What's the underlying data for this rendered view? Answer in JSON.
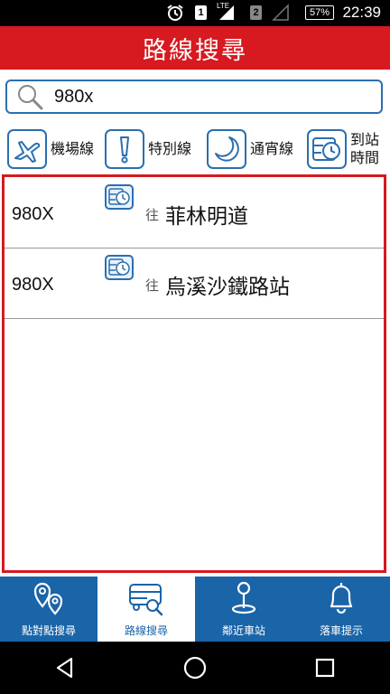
{
  "status": {
    "time": "22:39",
    "battery": "57%",
    "sim1": "1",
    "sim2": "2",
    "network": "LTE"
  },
  "title": "路線搜尋",
  "search": {
    "value": "980x"
  },
  "filters": [
    {
      "label": "機場線",
      "icon": "plane-icon"
    },
    {
      "label": "特別線",
      "icon": "exclamation-icon"
    },
    {
      "label": "通宵線",
      "icon": "moon-icon"
    },
    {
      "label": "到站時間",
      "line1": "到站",
      "line2": "時間",
      "icon": "bus-clock-icon"
    }
  ],
  "results": [
    {
      "route": "980X",
      "direction": "往",
      "destination": "菲林明道"
    },
    {
      "route": "980X",
      "direction": "往",
      "destination": "烏溪沙鐵路站"
    }
  ],
  "tabs": [
    {
      "label": "點對點搜尋",
      "icon": "map-pins-icon"
    },
    {
      "label": "路線搜尋",
      "icon": "bus-search-icon",
      "active": true
    },
    {
      "label": "鄰近車站",
      "icon": "location-pin-icon"
    },
    {
      "label": "落車提示",
      "icon": "bell-icon"
    }
  ],
  "colors": {
    "header": "#d71920",
    "accent": "#2a6fb0",
    "nav": "#1a64a8"
  }
}
